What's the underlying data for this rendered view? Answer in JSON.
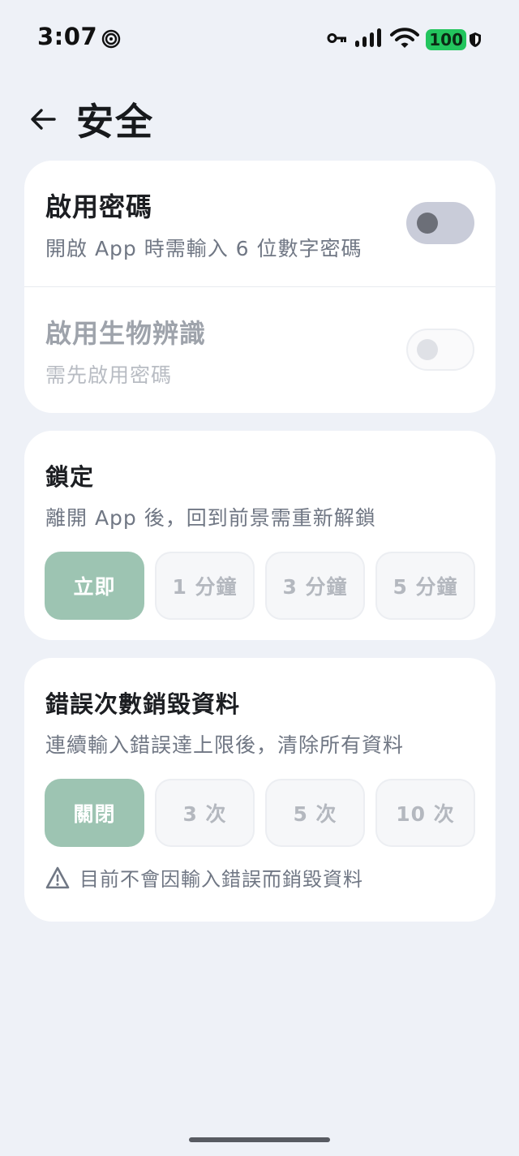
{
  "status_bar": {
    "time": "3:07",
    "battery": "100",
    "icons": [
      "spiral-icon",
      "key-icon",
      "signal-icon",
      "wifi-icon",
      "battery-icon",
      "shield-icon"
    ]
  },
  "header": {
    "back_icon": "arrow-left-icon",
    "title": "安全"
  },
  "passcode_card": {
    "passcode": {
      "title": "啟用密碼",
      "subtitle": "開啟 App 時需輸入 6 位數字密碼",
      "enabled": false
    },
    "biometric": {
      "title": "啟用生物辨識",
      "subtitle": "需先啟用密碼",
      "enabled": false,
      "disabled": true
    }
  },
  "lock_card": {
    "title": "鎖定",
    "subtitle": "離開 App 後，回到前景需重新解鎖",
    "options": [
      "立即",
      "1 分鐘",
      "3 分鐘",
      "5 分鐘"
    ],
    "selected": "立即"
  },
  "wipe_card": {
    "title": "錯誤次數銷毀資料",
    "subtitle": "連續輸入錯誤達上限後，清除所有資料",
    "options": [
      "關閉",
      "3 次",
      "5 次",
      "10 次"
    ],
    "selected": "關閉",
    "warning": "目前不會因輸入錯誤而銷毀資料",
    "warning_icon": "warning-icon"
  },
  "colors": {
    "background": "#eef1f7",
    "accent": "#9dc4b2",
    "battery": "#23c55e"
  }
}
